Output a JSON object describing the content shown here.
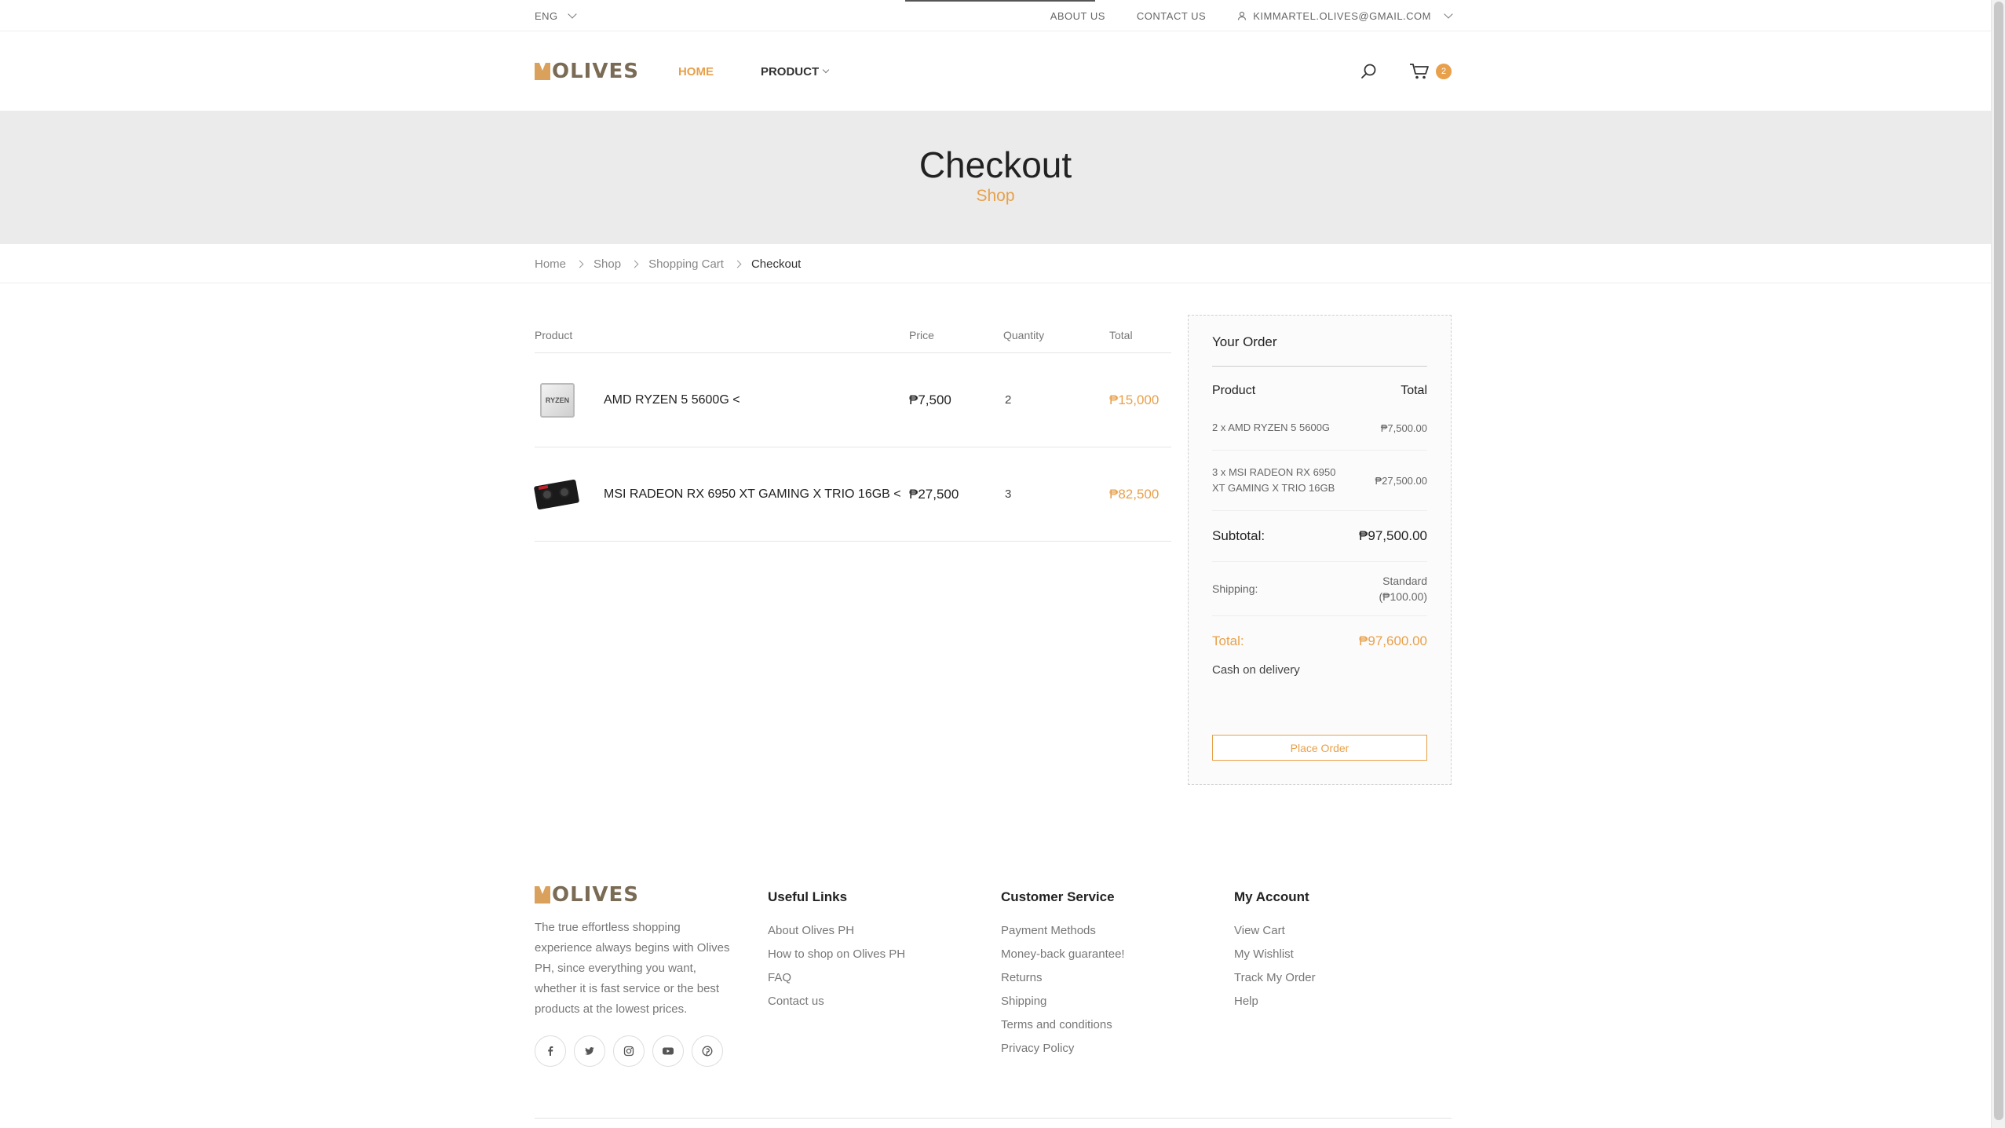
{
  "topbar": {
    "language": "ENG",
    "about": "ABOUT US",
    "contact": "CONTACT US",
    "user_email": "KIMMARTEL.OLIVES@GMAIL.COM"
  },
  "header": {
    "logo_text": "OLIVES",
    "nav_home": "HOME",
    "nav_product": "PRODUCT",
    "cart_count": "2"
  },
  "hero": {
    "title": "Checkout",
    "subtitle": "Shop"
  },
  "breadcrumb": [
    "Home",
    "Shop",
    "Shopping Cart",
    "Checkout"
  ],
  "table": {
    "headers": {
      "product": "Product",
      "price": "Price",
      "quantity": "Quantity",
      "total": "Total"
    },
    "rows": [
      {
        "name": "AMD RYZEN 5 5600G <",
        "price": "₱7,500",
        "qty": "2",
        "total": "₱15,000",
        "thumb_label": "RYZEN"
      },
      {
        "name": "MSI RADEON RX 6950 XT GAMING X TRIO 16GB <",
        "price": "₱27,500",
        "qty": "3",
        "total": "₱82,500"
      }
    ]
  },
  "order": {
    "title": "Your Order",
    "col_product": "Product",
    "col_total": "Total",
    "items": [
      {
        "name": "2 x AMD RYZEN 5 5600G",
        "total": "₱7,500.00"
      },
      {
        "name": "3 x MSI RADEON RX 6950 XT GAMING X TRIO 16GB",
        "total": "₱27,500.00"
      }
    ],
    "subtotal_label": "Subtotal:",
    "subtotal_value": "₱97,500.00",
    "shipping_label": "Shipping:",
    "shipping_line1": "Standard",
    "shipping_line2": "(₱100.00)",
    "total_label": "Total:",
    "total_value": "₱97,600.00",
    "payment_method": "Cash on delivery",
    "place_order": "Place Order"
  },
  "footer": {
    "logo_text": "OLIVES",
    "description": "The true effortless shopping experience always begins with Olives PH, since everything you want, whether it is fast service or the best products at the lowest prices.",
    "social_icons": [
      "facebook-icon",
      "twitter-icon",
      "instagram-icon",
      "youtube-icon",
      "pinterest-icon"
    ],
    "useful_links": {
      "title": "Useful Links",
      "items": [
        "About Olives PH",
        "How to shop on Olives PH",
        "FAQ",
        "Contact us"
      ]
    },
    "customer_service": {
      "title": "Customer Service",
      "items": [
        "Payment Methods",
        "Money-back guarantee!",
        "Returns",
        "Shipping",
        "Terms and conditions",
        "Privacy Policy"
      ]
    },
    "my_account": {
      "title": "My Account",
      "items": [
        "View Cart",
        "My Wishlist",
        "Track My Order",
        "Help"
      ]
    }
  },
  "colors": {
    "accent": "#e8a04a",
    "hero_bg": "#ebebeb"
  }
}
